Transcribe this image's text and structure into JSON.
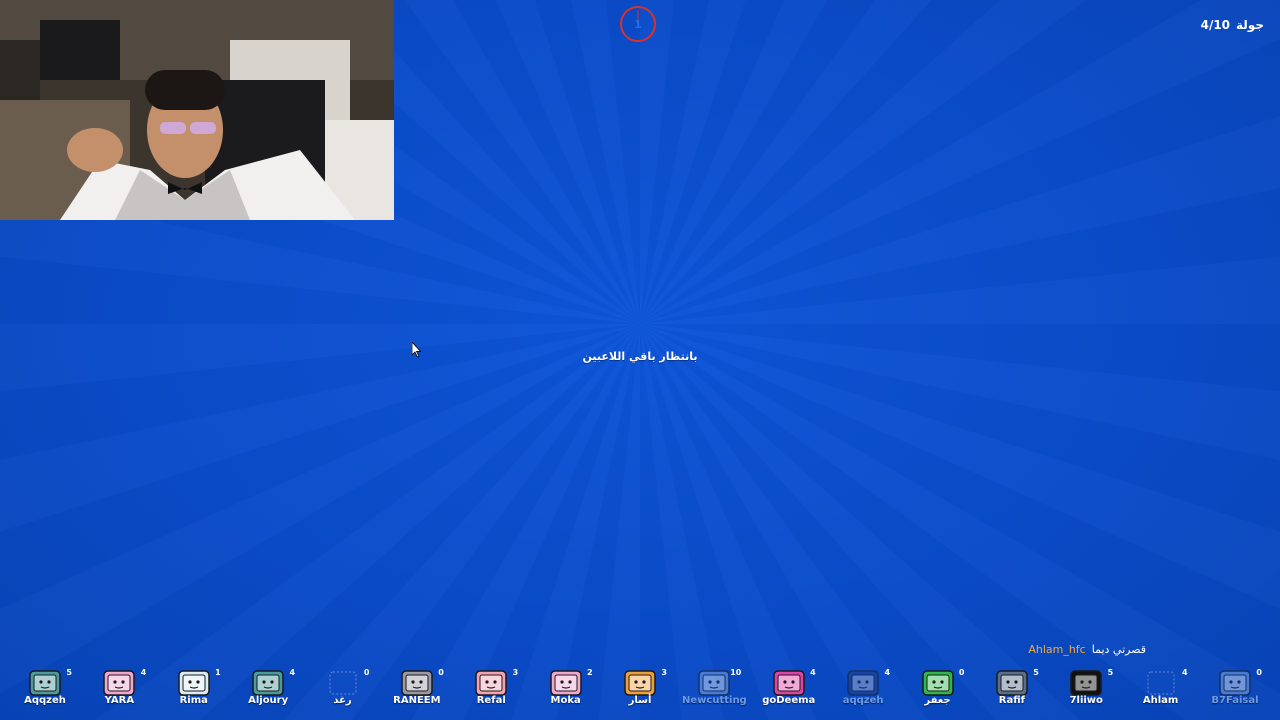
{
  "header": {
    "round_word": "جولة",
    "round_value": "4/10",
    "timer_value": "1"
  },
  "center": {
    "waiting_text": "بانتظار باقي اللاعبين"
  },
  "chat": {
    "username": "Ahlam_hfc",
    "message": "قصرتي ديما"
  },
  "colors": {
    "background": "#0a4ccb",
    "timer_ring": "#d9322b",
    "chat_username": "#f6a93b"
  },
  "players": [
    {
      "name": "Aqqzeh",
      "score": "5",
      "avatar_color": "#4a9a9e",
      "avatar_icon": "tv-avatar-icon"
    },
    {
      "name": "YARA",
      "score": "4",
      "avatar_color": "#f2a7d0",
      "avatar_icon": "tv-avatar-bow-icon"
    },
    {
      "name": "Rima",
      "score": "1",
      "avatar_color": "#dcecf3",
      "avatar_icon": "tv-avatar-icon"
    },
    {
      "name": "Aljoury",
      "score": "4",
      "avatar_color": "#4a9a9e",
      "avatar_icon": "tv-avatar-icon"
    },
    {
      "name": "رغد",
      "score": "0",
      "avatar_color": "#0a4ccb",
      "avatar_icon": "empty-avatar-icon"
    },
    {
      "name": "RANEEM",
      "score": "0",
      "avatar_color": "#9a9aa6",
      "avatar_icon": "tv-avatar-mask-icon"
    },
    {
      "name": "Refal",
      "score": "3",
      "avatar_color": "#f4a3b3",
      "avatar_icon": "tv-avatar-icon"
    },
    {
      "name": "Moka",
      "score": "2",
      "avatar_color": "#f2a7d0",
      "avatar_icon": "tv-avatar-bow-icon"
    },
    {
      "name": "أسار",
      "score": "3",
      "avatar_color": "#f0a03a",
      "avatar_icon": "tv-avatar-hair-icon"
    },
    {
      "name": "Newcutting",
      "score": "10",
      "avatar_color": "#7aa4e6",
      "avatar_icon": "tv-avatar-icon"
    },
    {
      "name": "goDeema",
      "score": "4",
      "avatar_color": "#e043a8",
      "avatar_icon": "tv-avatar-sunglasses-icon"
    },
    {
      "name": "aqqzeh",
      "score": "4",
      "avatar_color": "#1c3f8a",
      "avatar_icon": "tv-avatar-3mk-icon"
    },
    {
      "name": "جعفر",
      "score": "0",
      "avatar_color": "#2fb84c",
      "avatar_icon": "tv-avatar-face-icon"
    },
    {
      "name": "Rafif",
      "score": "5",
      "avatar_color": "#5a6f8c",
      "avatar_icon": "tv-avatar-horn-icon"
    },
    {
      "name": "7liiwo",
      "score": "5",
      "avatar_color": "#111111",
      "avatar_icon": "tv-avatar-angry-icon"
    },
    {
      "name": "Ahlam",
      "score": "4",
      "avatar_color": "#0a4ccb",
      "avatar_icon": "empty-avatar-icon"
    },
    {
      "name": "B7Faisal",
      "score": "0",
      "avatar_color": "#7aa4e6",
      "avatar_icon": "tv-avatar-icon"
    }
  ]
}
